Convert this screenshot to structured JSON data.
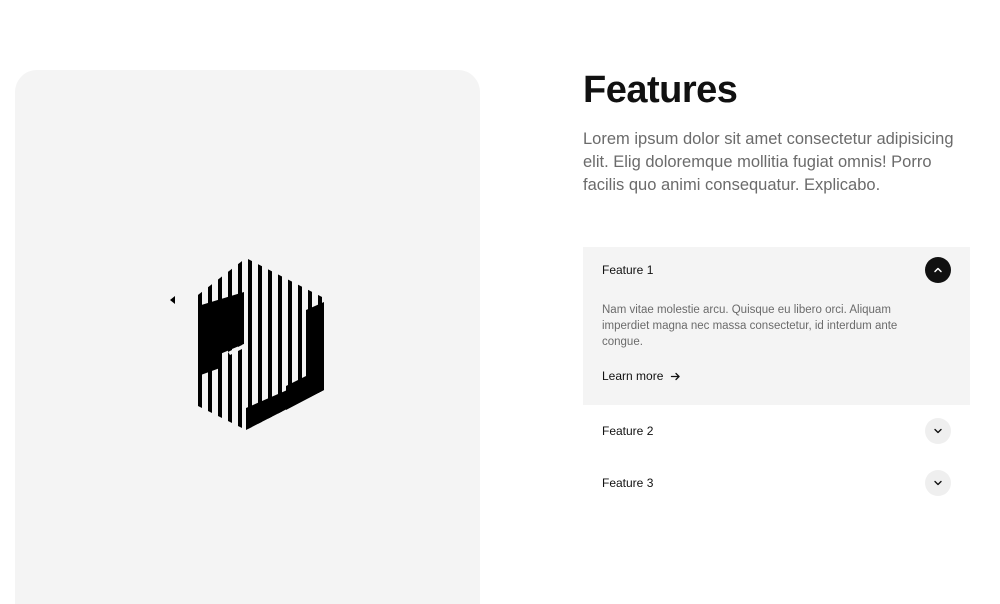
{
  "features": {
    "title": "Features",
    "intro": "Lorem ipsum dolor sit amet consectetur adipisicing elit. Elig doloremque mollitia fugiat omnis! Porro facilis quo animi consequatur. Explicabo.",
    "items": [
      {
        "label": "Feature 1",
        "expanded": true,
        "body": "Nam vitae molestie arcu. Quisque eu libero orci. Aliquam imperdiet magna nec massa consectetur, id interdum ante congue.",
        "link_label": "Learn more",
        "toggle_icon": "chevron-up-icon"
      },
      {
        "label": "Feature 2",
        "expanded": false,
        "toggle_icon": "chevron-down-icon"
      },
      {
        "label": "Feature 3",
        "expanded": false,
        "toggle_icon": "chevron-down-icon"
      }
    ]
  },
  "media": {
    "logo_icon": "striped-hexagon-logo",
    "card_color": "#f4f4f4"
  },
  "colors": {
    "text": "#111111",
    "muted": "#6b6b6b",
    "panel": "#f4f4f4",
    "toggle_active": "#111111",
    "toggle_inactive": "#efefef"
  }
}
